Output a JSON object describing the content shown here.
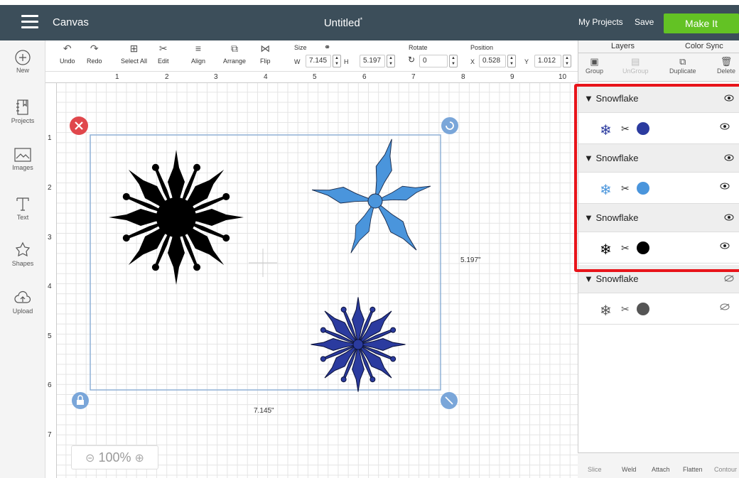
{
  "topbar": {
    "app_title": "Canvas",
    "doc_title": "Untitled",
    "doc_mark": "*",
    "my_projects": "My Projects",
    "save": "Save",
    "make_it": "Make It"
  },
  "leftbar": {
    "new": "New",
    "projects": "Projects",
    "images": "Images",
    "text": "Text",
    "shapes": "Shapes",
    "upload": "Upload"
  },
  "toolbar": {
    "undo": "Undo",
    "redo": "Redo",
    "select_all": "Select All",
    "edit": "Edit",
    "align": "Align",
    "arrange": "Arrange",
    "flip": "Flip",
    "size_label": "Size",
    "w_label": "W",
    "w_value": "7.145",
    "h_label": "H",
    "h_value": "5.197",
    "rotate_label": "Rotate",
    "rotate_value": "0",
    "position_label": "Position",
    "x_label": "X",
    "x_value": "0.528",
    "y_label": "Y",
    "y_value": "1.012"
  },
  "ruler": {
    "x": [
      "1",
      "2",
      "3",
      "4",
      "5",
      "6",
      "7",
      "8",
      "9",
      "10"
    ],
    "y": [
      "1",
      "2",
      "3",
      "4",
      "5",
      "6",
      "7"
    ]
  },
  "canvas": {
    "width_dim": "7.145\"",
    "height_dim": "5.197\"",
    "zoom": "100%"
  },
  "panel": {
    "tabs": [
      "Layers",
      "Color Sync"
    ],
    "tools": [
      "Group",
      "UnGroup",
      "Duplicate",
      "Delete"
    ],
    "layers": [
      {
        "name": "Snowflake",
        "color": "#2b3b9f",
        "visible": true
      },
      {
        "name": "Snowflake",
        "color": "#4a95dc",
        "visible": true
      },
      {
        "name": "Snowflake",
        "color": "#000000",
        "visible": true
      },
      {
        "name": "Snowflake",
        "color": "#555555",
        "visible": false
      }
    ],
    "bottom": [
      "Slice",
      "Weld",
      "Attach",
      "Flatten",
      "Contour"
    ]
  }
}
